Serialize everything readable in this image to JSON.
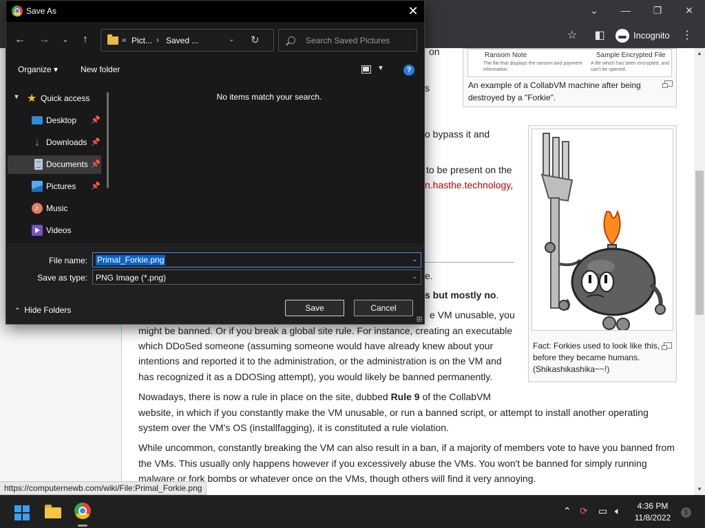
{
  "browser": {
    "incognito_label": "Incognito",
    "status_url": "https://computernewb.com/wiki/File:Primal_Forkie.png"
  },
  "article": {
    "frag1": "on",
    "frag2": "s",
    "frag3": "o bypass it and",
    "frag4": "to be present on the",
    "frag5_link": "n.hasthe.technology",
    "frag5_end": ",",
    "frag6": "e.",
    "frag7": "s but mostly no",
    "frag7_end": ".",
    "frag8": "e VM unusable, you",
    "para1_lines": [
      "might be banned. Or if you break a global site rule. For instance, creating an executable",
      "which DDoSed someone (assuming someone would have already knew about your",
      "intentions and reported it to the administration, or the administration is on the VM and",
      "has recognized it as a DDOSing attempt), you would likely be banned permanently."
    ],
    "para2_l1_a": "Nowadays, there is now a rule in place on the site, dubbed ",
    "para2_l1_b": "Rule 9",
    "para2_l1_c": " of the CollabVM",
    "para2_lines": [
      "website, in which if you constantly make the VM unusable, or run a banned script, or attempt to install another operating",
      "system over the VM's OS (installfagging), it is constituted a rule violation."
    ],
    "para3_lines": [
      "While uncommon, constantly breaking the VM can also result in a ban, if a majority of members vote to have you banned from",
      "the VMs. This usually only happens however if you excessively abuse the VMs. You won't be banned for simply running",
      "malware or fork bombs or whatever once on the VMs, though others will find it very annoying."
    ],
    "thumb1": {
      "img_text_a": "Ransom Note",
      "img_text_b": "Sample Encrypted File",
      "img_sub_a": "The file that displays the ransom and payment information.",
      "img_sub_b": "A file which has been encrypted, and can't be opened.",
      "caption": "An example of a CollabVM machine after being destroyed by a \"Forkie\"."
    },
    "thumb2": {
      "caption": "Fact: Forkies used to look like this, before they became humans. (Shikashikashika~~!)"
    }
  },
  "dialog": {
    "title": "Save As",
    "address": {
      "overflow": "«",
      "crumb1": "Pict...",
      "sep": "›",
      "crumb2": "Saved ..."
    },
    "search": {
      "placeholder": "Search Saved Pictures"
    },
    "commands": {
      "organize": "Organize ▾",
      "new_folder": "New folder"
    },
    "quick_access": "Quick access",
    "nav_items": [
      {
        "label": "Desktop",
        "pinned": true
      },
      {
        "label": "Downloads",
        "pinned": true
      },
      {
        "label": "Documents",
        "pinned": true
      },
      {
        "label": "Pictures",
        "pinned": true
      },
      {
        "label": "Music",
        "pinned": false
      },
      {
        "label": "Videos",
        "pinned": false
      }
    ],
    "empty_message": "No items match your search.",
    "file_name_label": "File name:",
    "file_name_value": "Primal_Forkie.png",
    "save_as_type_label": "Save as type:",
    "save_as_type_value": "PNG Image (*.png)",
    "hide_folders": "Hide Folders",
    "save_label": "Save",
    "cancel_label": "Cancel",
    "help_glyph": "?"
  },
  "taskbar": {
    "time": "4:36 PM",
    "date": "11/8/2022",
    "notification_count": "1"
  },
  "colors": {
    "dialog_bg": "#202020",
    "selection": "#0a64c8",
    "link_red": "#ba0000",
    "accent_blue": "#2b7de0"
  }
}
